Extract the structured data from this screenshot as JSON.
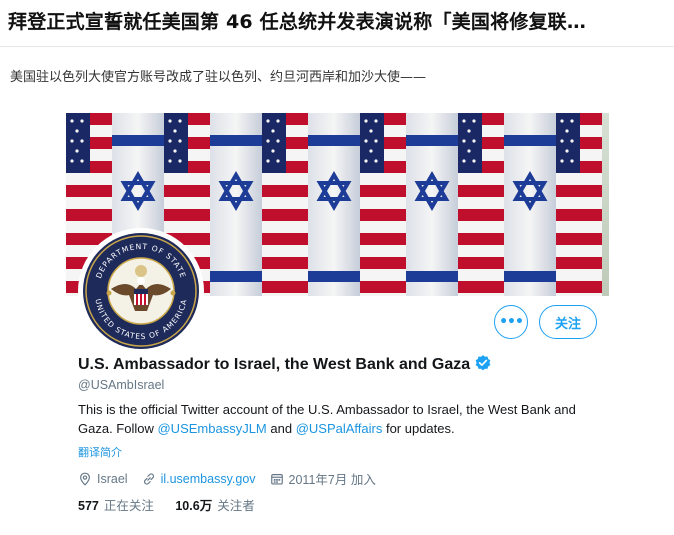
{
  "headline": "拜登正式宣誓就任美国第 46 任总统并发表演说称「美国将修复联…",
  "intro": "美国驻以色列大使官方账号改成了驻以色列、约旦河西岸和加沙大使——",
  "profile": {
    "more_label": "•••",
    "follow_label": "关注",
    "name": "U.S. Ambassador to Israel, the West Bank and Gaza",
    "handle": "@USAmbIsrael",
    "bio_text_1": "This is the official Twitter account of the U.S. Ambassador to Israel, the West Bank and Gaza. Follow ",
    "bio_link_1": "@USEmbassyJLM",
    "bio_text_2": " and ",
    "bio_link_2": "@USPalAffairs",
    "bio_text_3": " for updates.",
    "translate": "翻译简介",
    "location": "Israel",
    "website": "il.usembassy.gov",
    "joined": "2011年7月 加入",
    "following_count": "577",
    "following_label": "正在关注",
    "followers_count": "10.6万",
    "followers_label": "关注者"
  },
  "seal": {
    "top_text": "DEPARTMENT OF STATE",
    "bottom_text": "UNITED STATES OF AMERICA"
  },
  "colors": {
    "accent": "#1da1f2",
    "link": "#1b95e0",
    "israel_blue": "#1f3f9e",
    "us_red": "#c8102e"
  }
}
